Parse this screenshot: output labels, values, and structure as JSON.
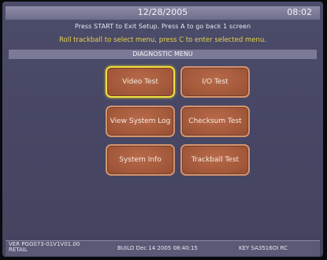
{
  "header": {
    "date": "12/28/2005",
    "time": "08:02"
  },
  "instructions": {
    "line1": "Press START to Exit Setup. Press A to go back 1 screen",
    "line2": "Roll trackball to select menu, press C to enter selected menu."
  },
  "menu": {
    "title": "DIAGNOSTIC MENU",
    "items": [
      {
        "label": "Video Test",
        "selected": true
      },
      {
        "label": "I/O Test",
        "selected": false
      },
      {
        "label": "View System Log",
        "selected": false
      },
      {
        "label": "Checksum Test",
        "selected": false
      },
      {
        "label": "System Info",
        "selected": false
      },
      {
        "label": "Trackball Test",
        "selected": false
      }
    ]
  },
  "footer": {
    "ver_line1": "VER  PGG073-01V1V01.00",
    "ver_line2": "RETAIL",
    "build": "BUILD  Dec 14 2005  08:40:15",
    "key": "KEY  SA3516OI RC"
  },
  "colors": {
    "background": "#474765",
    "button_fill": "#a55a3c",
    "button_border": "#d39470",
    "selected_border": "#f0e040",
    "instruction_highlight": "#e6d24a"
  }
}
